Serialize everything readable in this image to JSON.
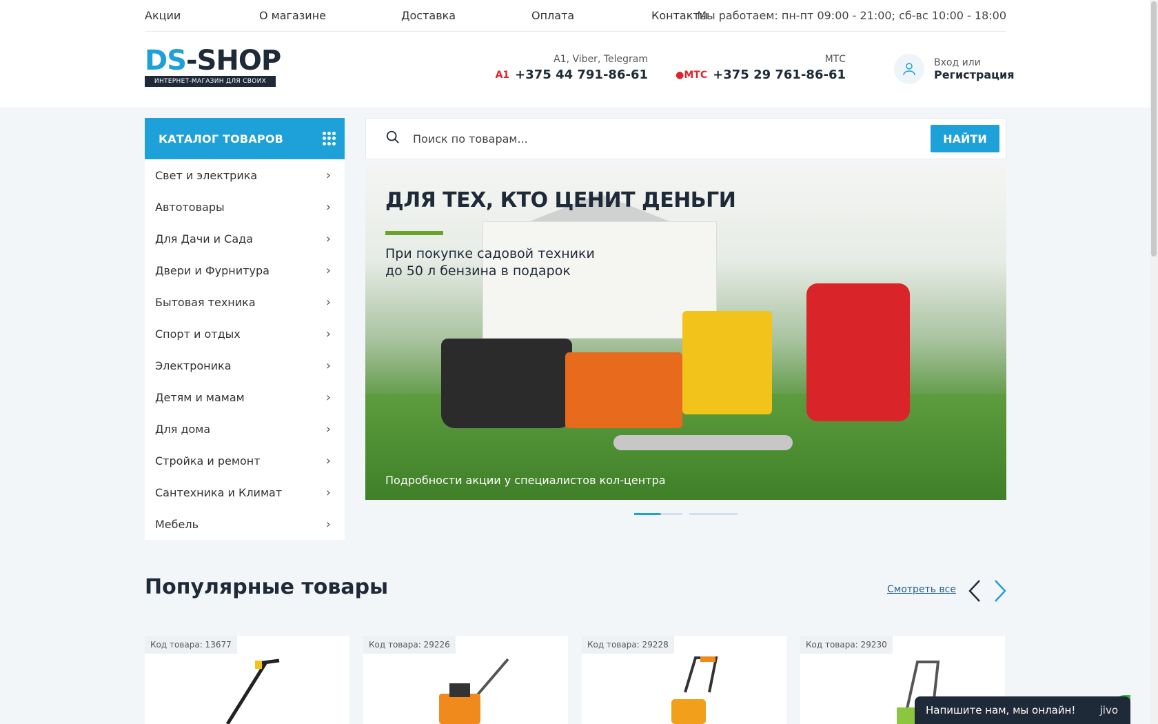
{
  "topnav": {
    "items": [
      "Акции",
      "О магазине",
      "Доставка",
      "Оплата",
      "Контакты"
    ],
    "hours": "Мы работаем: пн-пт 09:00 - 21:00; сб-вс 10:00 - 18:00"
  },
  "logo": {
    "part1": "DS",
    "part2": "-SHOP",
    "tagline": "ИНТЕРНЕТ-МАГАЗИН ДЛЯ СВОИХ"
  },
  "phones": [
    {
      "caption": "A1, Viber, Telegram",
      "operator": "A1",
      "number": "+375 44 791-86-61"
    },
    {
      "caption": "МТС",
      "operator": "МТС",
      "number": "+375 29 761-86-61"
    }
  ],
  "account": {
    "line1": "Вход или",
    "line2": "Регистрация"
  },
  "catalog": {
    "title": "КАТАЛОГ ТОВАРОВ",
    "items": [
      "Свет и электрика",
      "Автотовары",
      "Для Дачи и Сада",
      "Двери и Фурнитура",
      "Бытовая техника",
      "Спорт и отдых",
      "Электроника",
      "Детям и мамам",
      "Для дома",
      "Стройка и ремонт",
      "Сантехника и Климат",
      "Мебель"
    ]
  },
  "search": {
    "placeholder": "Поиск по товарам...",
    "button": "НАЙТИ"
  },
  "banner": {
    "headline": "ДЛЯ ТЕХ, КТО ЦЕНИТ ДЕНЬГИ",
    "sub_line1": "При покупке садовой техники",
    "sub_line2": "до 50 л бензина в подарок",
    "note": "Подробности акции у специалистов кол-центра",
    "slides": 2,
    "active_slide": 1
  },
  "popular": {
    "title": "Популярные товары",
    "see_all": "Смотреть все",
    "products": [
      {
        "code": "Код товара: 13677"
      },
      {
        "code": "Код товара: 29226"
      },
      {
        "code": "Код товара: 29228"
      },
      {
        "code": "Код товара: 29230"
      }
    ]
  },
  "chat": {
    "text": "Напишите нам, мы онлайн!",
    "brand": "jivo"
  },
  "colors": {
    "accent": "#1ea0d8",
    "dark": "#1f2a38",
    "green": "#6aa32b",
    "mts_red": "#e1232b"
  }
}
